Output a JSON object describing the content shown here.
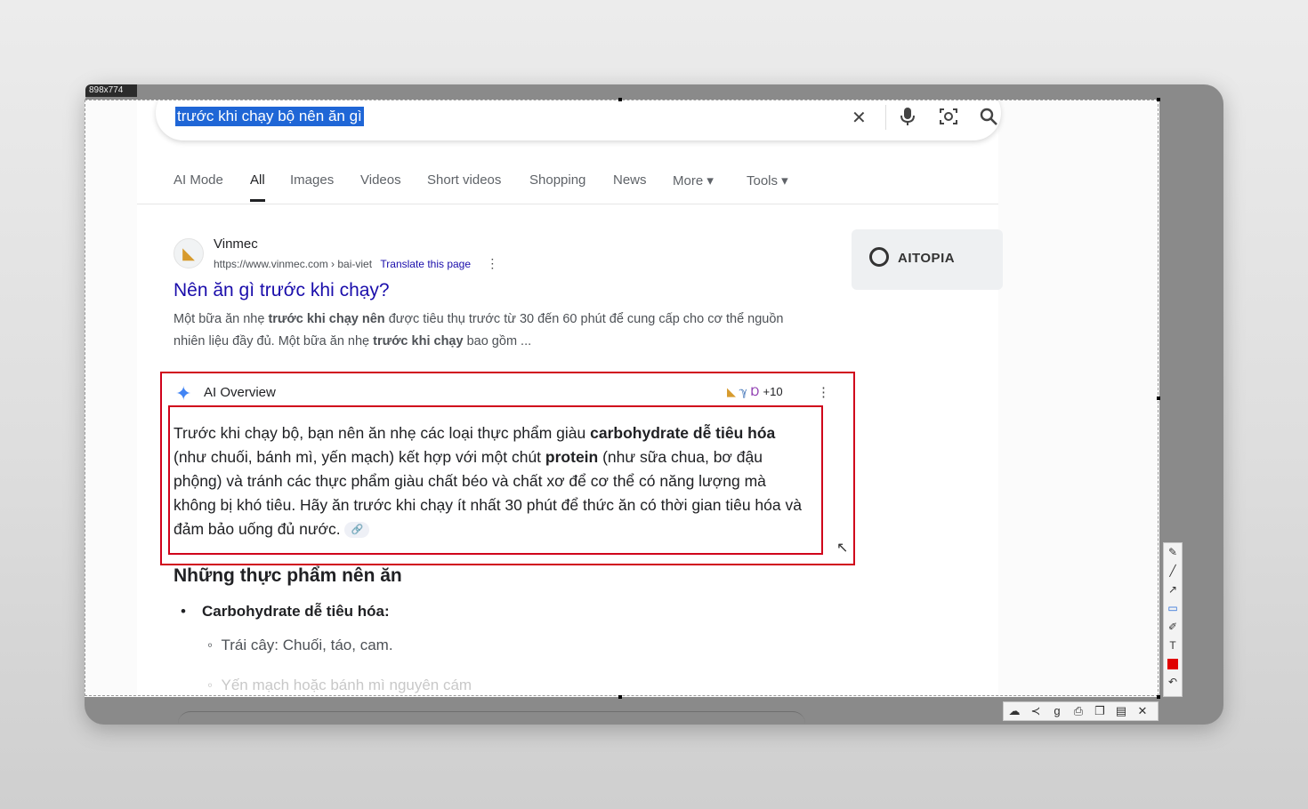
{
  "capture": {
    "dimensions_tag": "898x774"
  },
  "search": {
    "query": "trước khi chạy bộ nên ăn gì",
    "icons": [
      "close-icon",
      "mic-icon",
      "lens-icon",
      "search-icon"
    ]
  },
  "tabs": [
    {
      "label": "AI Mode"
    },
    {
      "label": "All",
      "active": true
    },
    {
      "label": "Images"
    },
    {
      "label": "Videos"
    },
    {
      "label": "Short videos"
    },
    {
      "label": "Shopping"
    },
    {
      "label": "News"
    },
    {
      "label": "More ▾"
    },
    {
      "label": "Tools ▾"
    }
  ],
  "result": {
    "site": "Vinmec",
    "url": "https://www.vinmec.com › bai-viet",
    "translate": "Translate this page",
    "title": "Nên ăn gì trước khi chạy?",
    "snippet_parts": [
      {
        "t": "Một bữa ăn nhẹ "
      },
      {
        "t": "trước khi chạy nên",
        "b": true
      },
      {
        "t": " được tiêu thụ trước từ 30 đến 60 phút để cung cấp cho cơ thể nguồn nhiên liệu đầy đủ. Một bữa ăn nhẹ "
      },
      {
        "t": "trước khi chạy",
        "b": true
      },
      {
        "t": " bao gồm ..."
      }
    ]
  },
  "sidebar": {
    "aitopia_label": "AITOPIA"
  },
  "ai_overview": {
    "label": "AI Overview",
    "sources_more": "+10",
    "parts": [
      {
        "t": "Trước khi chạy bộ, bạn nên ăn nhẹ các loại thực phẩm giàu "
      },
      {
        "t": "carbohydrate dễ tiêu hóa",
        "b": true
      },
      {
        "t": " (như chuối, bánh mì, yến mạch) kết hợp với một chút "
      },
      {
        "t": "protein",
        "b": true
      },
      {
        "t": " (như sữa chua, bơ đậu phộng) và tránh các thực phẩm giàu chất béo và chất xơ để cơ thể có năng lượng mà không bị khó tiêu. Hãy ăn trước khi chạy ít nhất 30 phút để thức ăn có thời gian tiêu hóa và đảm bảo uống đủ nước. "
      }
    ]
  },
  "section": {
    "heading": "Những thực phẩm nên ăn",
    "bullet1": "Carbohydrate dễ tiêu hóa:",
    "sub1": "Trái cây: Chuối, táo, cam.",
    "sub2_faded": "Yến mạch hoặc bánh mì nguyên cám"
  },
  "colors": {
    "link": "#1a0dab",
    "annotation_red": "#d0021b",
    "selection": "#1f66d6"
  }
}
